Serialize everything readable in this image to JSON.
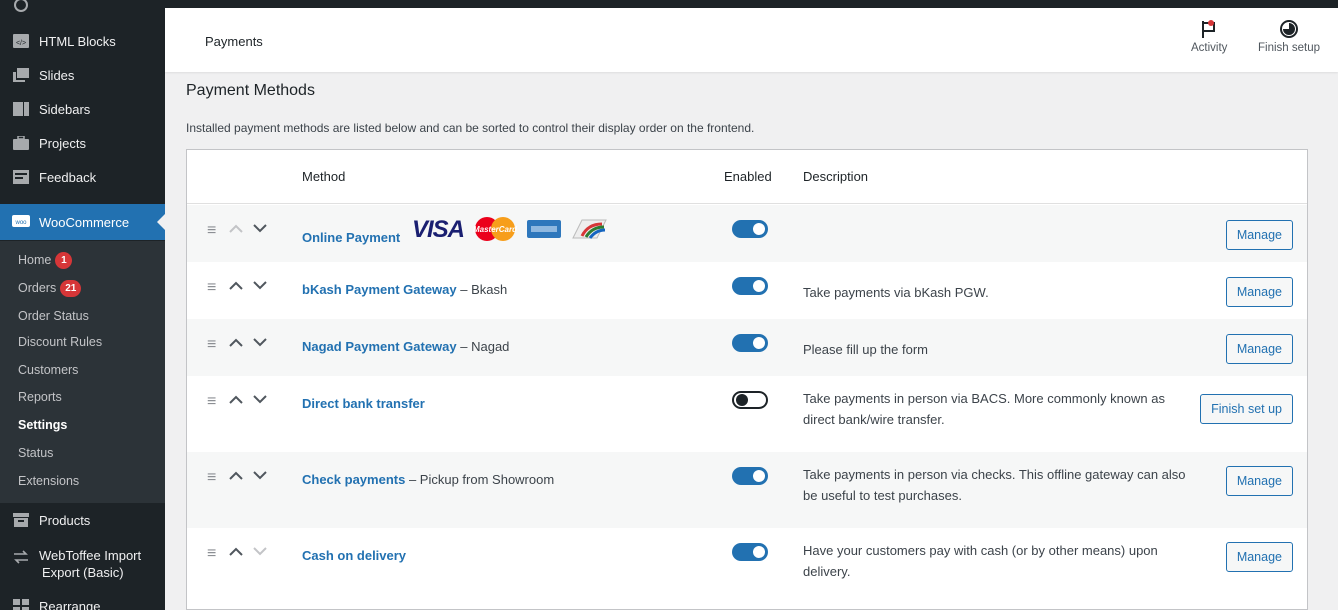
{
  "sidebar": {
    "items": [
      {
        "label": "HTML Blocks",
        "icon": "html-blocks-icon"
      },
      {
        "label": "Slides",
        "icon": "slides-icon"
      },
      {
        "label": "Sidebars",
        "icon": "sidebars-icon"
      },
      {
        "label": "Projects",
        "icon": "projects-icon"
      },
      {
        "label": "Feedback",
        "icon": "feedback-icon"
      },
      {
        "label": "WooCommerce",
        "icon": "woocommerce-icon"
      },
      {
        "label": "Products",
        "icon": "products-icon"
      },
      {
        "label": "WebToffee Import Export (Basic)",
        "line1": "WebToffee Import",
        "line2": "Export (Basic)",
        "icon": "import-export-icon"
      },
      {
        "label": "Rearrange",
        "icon": "rearrange-icon"
      }
    ],
    "submenu": [
      {
        "label": "Home",
        "badge": "1"
      },
      {
        "label": "Orders",
        "badge": "21"
      },
      {
        "label": "Order Status"
      },
      {
        "label": "Discount Rules"
      },
      {
        "label": "Customers"
      },
      {
        "label": "Reports"
      },
      {
        "label": "Settings",
        "current": true
      },
      {
        "label": "Status"
      },
      {
        "label": "Extensions"
      }
    ]
  },
  "header": {
    "title": "Payments",
    "activity_label": "Activity",
    "finish_setup_label": "Finish setup"
  },
  "page": {
    "title": "Payment Methods",
    "description": "Installed payment methods are listed below and can be sorted to control their display order on the frontend."
  },
  "table": {
    "columns": {
      "method": "Method",
      "enabled": "Enabled",
      "description": "Description"
    },
    "rows": [
      {
        "method": "Online Payment",
        "subtitle": "",
        "enabled": true,
        "description": "",
        "button": "Manage",
        "has_card_logos": true
      },
      {
        "method": "bKash Payment Gateway",
        "subtitle": "– Bkash",
        "enabled": true,
        "description": "Take payments via bKash PGW.",
        "button": "Manage"
      },
      {
        "method": "Nagad Payment Gateway",
        "subtitle": "– Nagad",
        "enabled": true,
        "description": "Please fill up the form",
        "button": "Manage"
      },
      {
        "method": "Direct bank transfer",
        "subtitle": "",
        "enabled": false,
        "description": "Take payments in person via BACS. More commonly known as direct bank/wire transfer.",
        "button": "Finish set up"
      },
      {
        "method": "Check payments",
        "subtitle": "– Pickup from Showroom",
        "enabled": true,
        "description": "Take payments in person via checks. This offline gateway can also be useful to test purchases.",
        "button": "Manage"
      },
      {
        "method": "Cash on delivery",
        "subtitle": "",
        "enabled": true,
        "description": "Have your customers pay with cash (or by other means) upon delivery.",
        "button": "Manage"
      }
    ]
  },
  "card_logos": {
    "visa": "VISA",
    "mastercard": "MasterCard"
  },
  "colors": {
    "accent": "#2271b1",
    "sidebar_bg": "#1d2327",
    "badge": "#d63638"
  }
}
